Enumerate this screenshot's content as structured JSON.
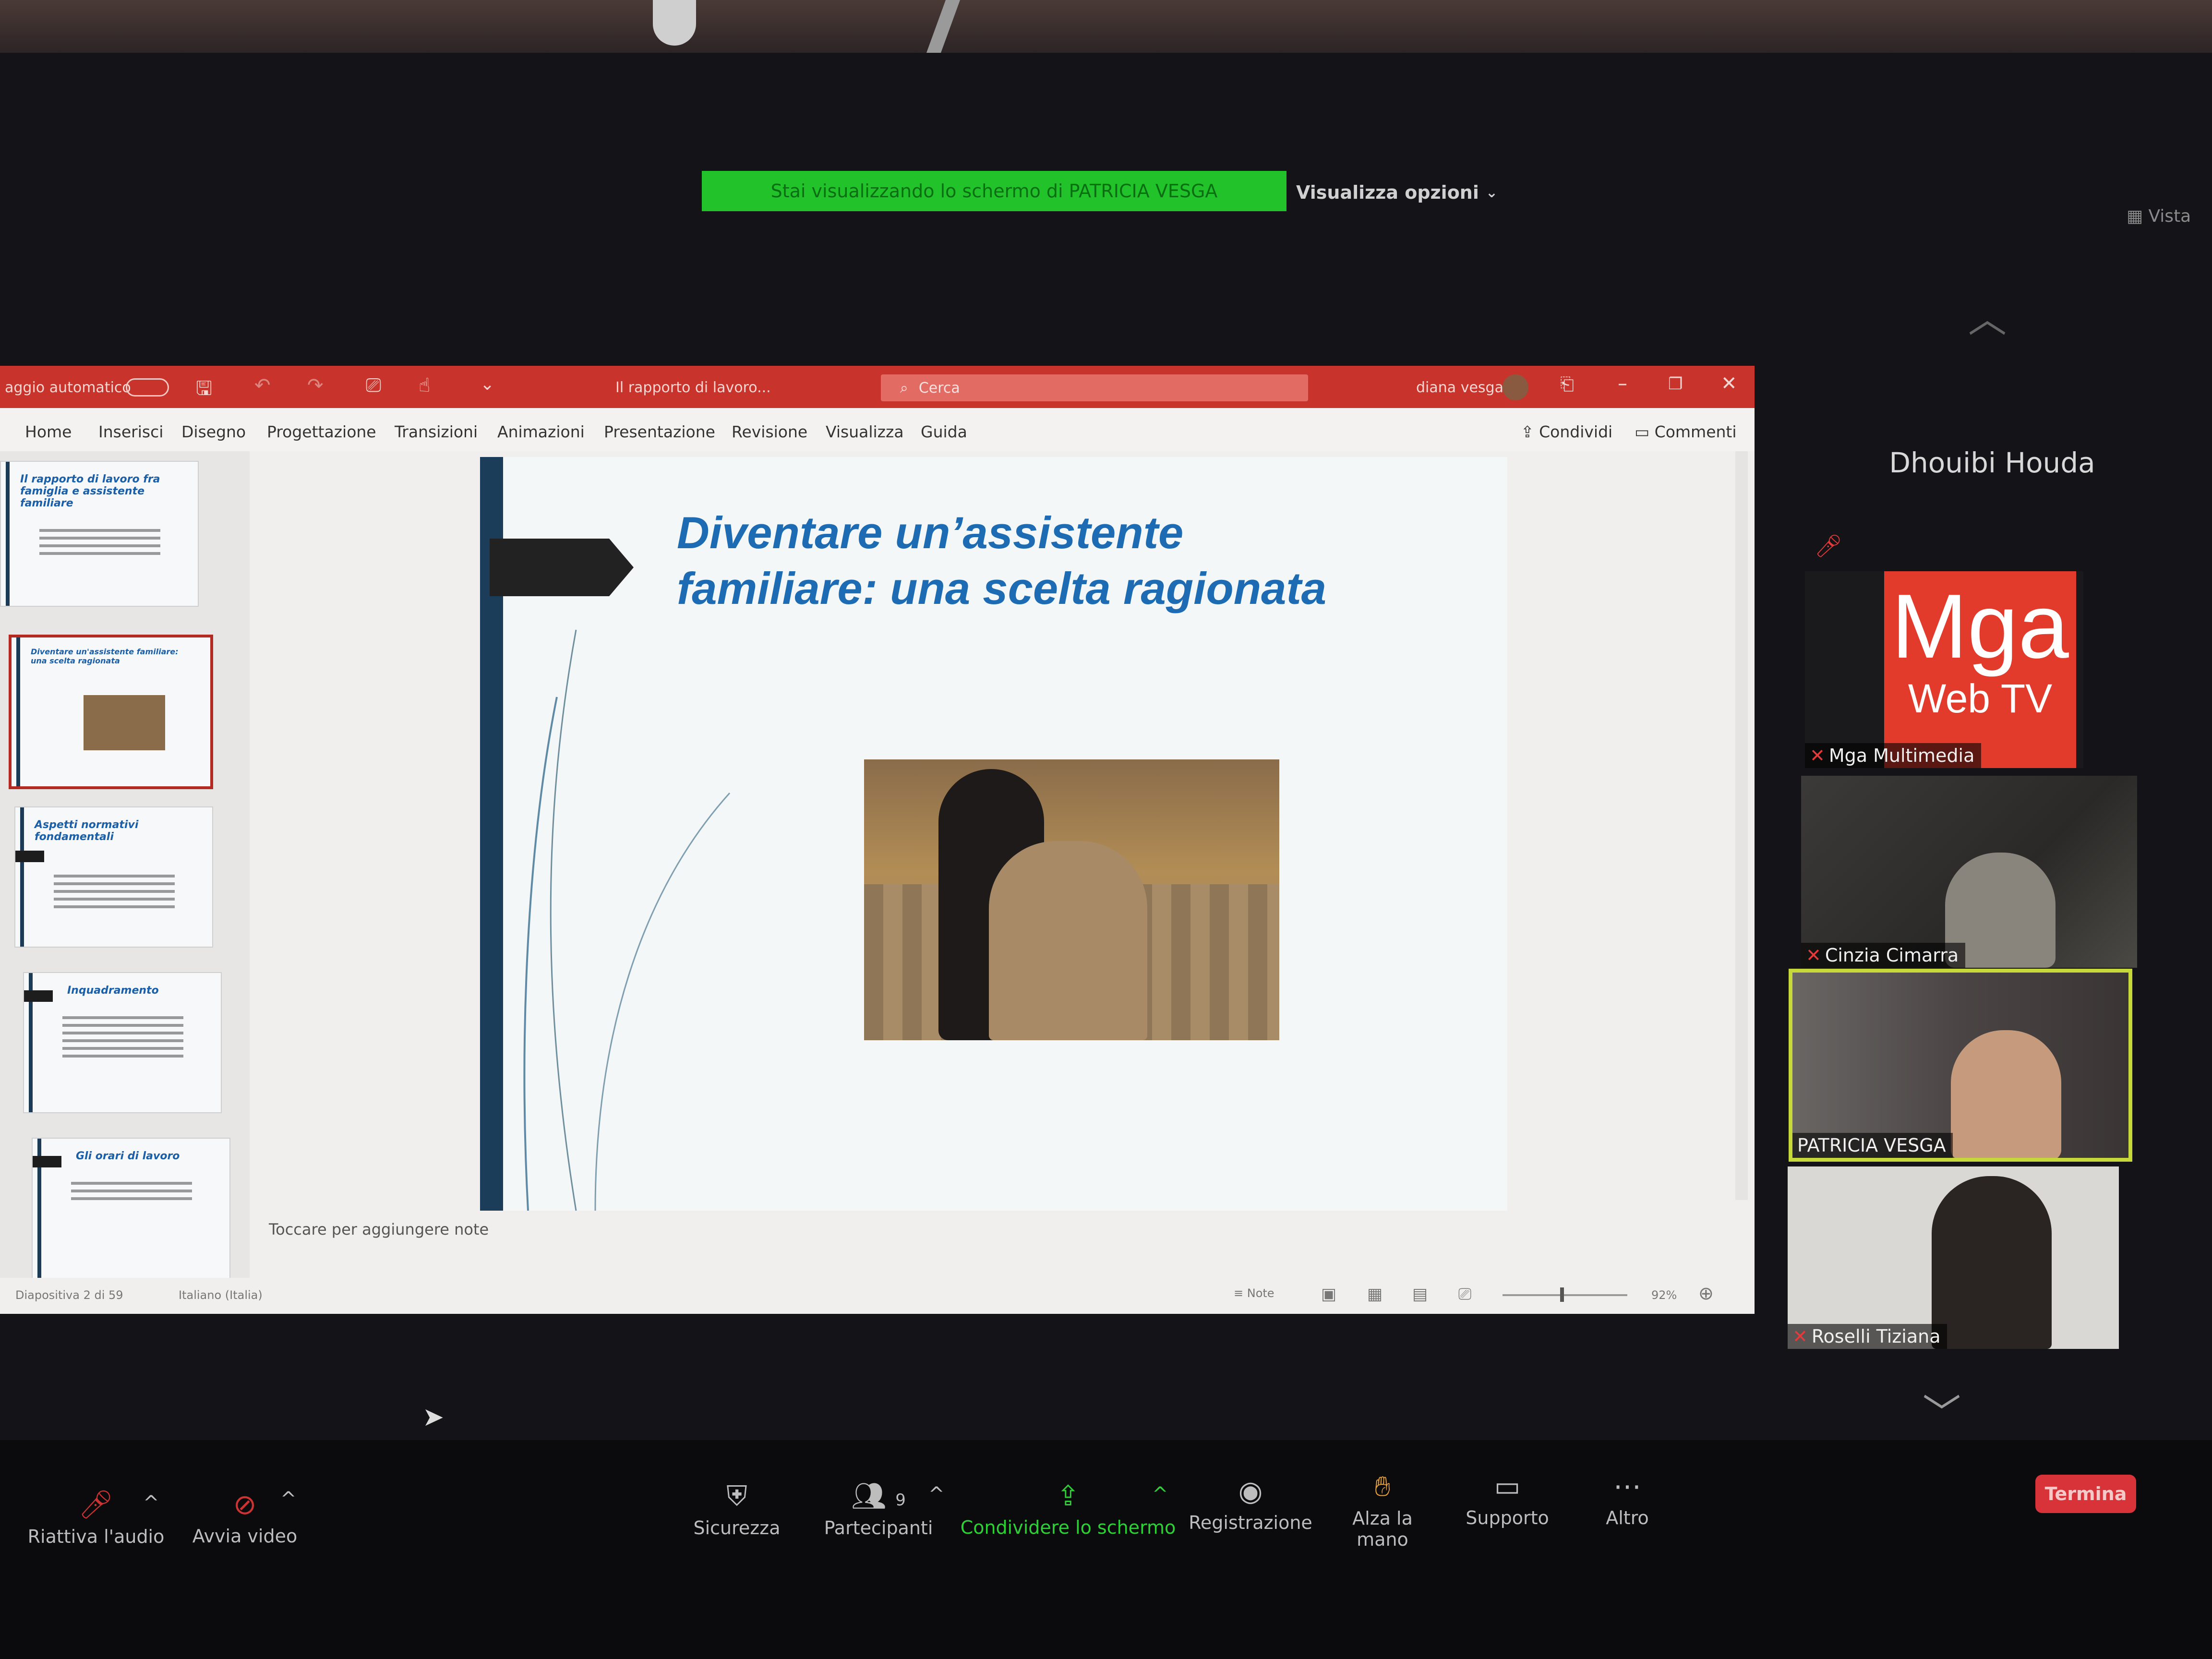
{
  "zoom": {
    "share_banner": "Stai visualizzando lo schermo di PATRICIA VESGA",
    "view_options": "Visualizza opzioni",
    "view_label": "Vista",
    "active_speaker": "Dhouibi Houda",
    "participants": [
      {
        "name": "Mga Multimedia",
        "logo_line1": "Mga",
        "logo_line2": "Web TV",
        "muted": true
      },
      {
        "name": "Cinzia Cimarra",
        "muted": true
      },
      {
        "name": "PATRICIA VESGA",
        "muted": false,
        "active": true
      },
      {
        "name": "Roselli Tiziana",
        "muted": true
      }
    ],
    "toolbar": {
      "audio": "Riattiva l'audio",
      "video": "Avvia video",
      "security": "Sicurezza",
      "participants": "Partecipanti",
      "participants_count": "9",
      "share_screen": "Condividere lo schermo",
      "record": "Registrazione",
      "raise_hand": "Alza la mano",
      "support": "Supporto",
      "more": "Altro",
      "end": "Termina"
    },
    "colors": {
      "share_green": "#22c22a",
      "end_red": "#d9333a",
      "active_border": "#c7d83a"
    }
  },
  "powerpoint": {
    "autosave": "aggio automatico",
    "doc_title": "Il rapporto di lavoro...",
    "search_placeholder": "Cerca",
    "user": "diana vesga",
    "menu": [
      "Home",
      "Inserisci",
      "Disegno",
      "Progettazione",
      "Transizioni",
      "Animazioni",
      "Presentazione",
      "Revisione",
      "Visualizza",
      "Guida"
    ],
    "share": "Condividi",
    "comments": "Commenti",
    "thumbnails": [
      {
        "title": "Il rapporto di lavoro fra famiglia e assistente familiare"
      },
      {
        "title": "Diventare un'assistente familiare: una scelta ragionata"
      },
      {
        "title": "Aspetti normativi fondamentali"
      },
      {
        "title": "Inquadramento"
      },
      {
        "title": "Gli orari di lavoro"
      }
    ],
    "slide_title_line1": "Diventare un’assistente",
    "slide_title_line2": "familiare: una scelta ragionata",
    "notes_placeholder": "Toccare per aggiungere note",
    "status_slide": "Diapositiva 2 di 59",
    "status_lang": "Italiano (Italia)",
    "notes_button": "Note",
    "zoom_level": "92%",
    "colors": {
      "titlebar": "#c8342b",
      "slide_title": "#1d6cb3"
    }
  }
}
